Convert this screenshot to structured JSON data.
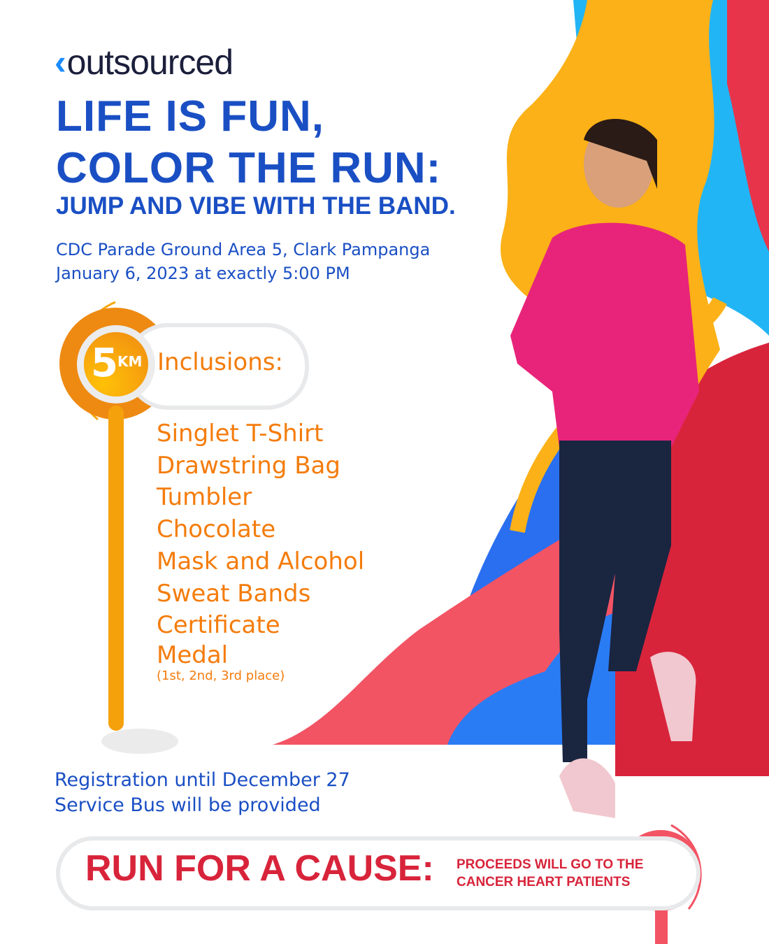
{
  "logo": {
    "text": "outsourced",
    "mark": "‹"
  },
  "headline": {
    "line1": "LIFE IS FUN,",
    "line2": "COLOR THE RUN:",
    "sub": "JUMP AND VIBE WITH THE BAND."
  },
  "event": {
    "venue": "CDC Parade Ground Area 5, Clark Pampanga",
    "datetime": "January 6, 2023 at exactly 5:00 PM"
  },
  "distance": {
    "value": "5",
    "unit": "KM"
  },
  "inclusions": {
    "title": "Inclusions:",
    "items": [
      "Singlet T-Shirt",
      "Drawstring Bag",
      "Tumbler",
      "Chocolate",
      "Mask and Alcohol",
      "Sweat Bands",
      "Certificate",
      "Medal"
    ],
    "medal_note": "(1st, 2nd, 3rd place)"
  },
  "footer": {
    "registration": "Registration until December 27",
    "bus": "Service Bus will be provided"
  },
  "cause": {
    "title": "RUN FOR A CAUSE:",
    "line1": "PROCEEDS WILL GO TO THE",
    "line2": "CANCER HEART PATIENTS"
  },
  "colors": {
    "blue": "#1a4fc4",
    "orange": "#f47c0c",
    "red": "#d8243b",
    "yellow": "#ffc107",
    "sky": "#22b5f5"
  }
}
